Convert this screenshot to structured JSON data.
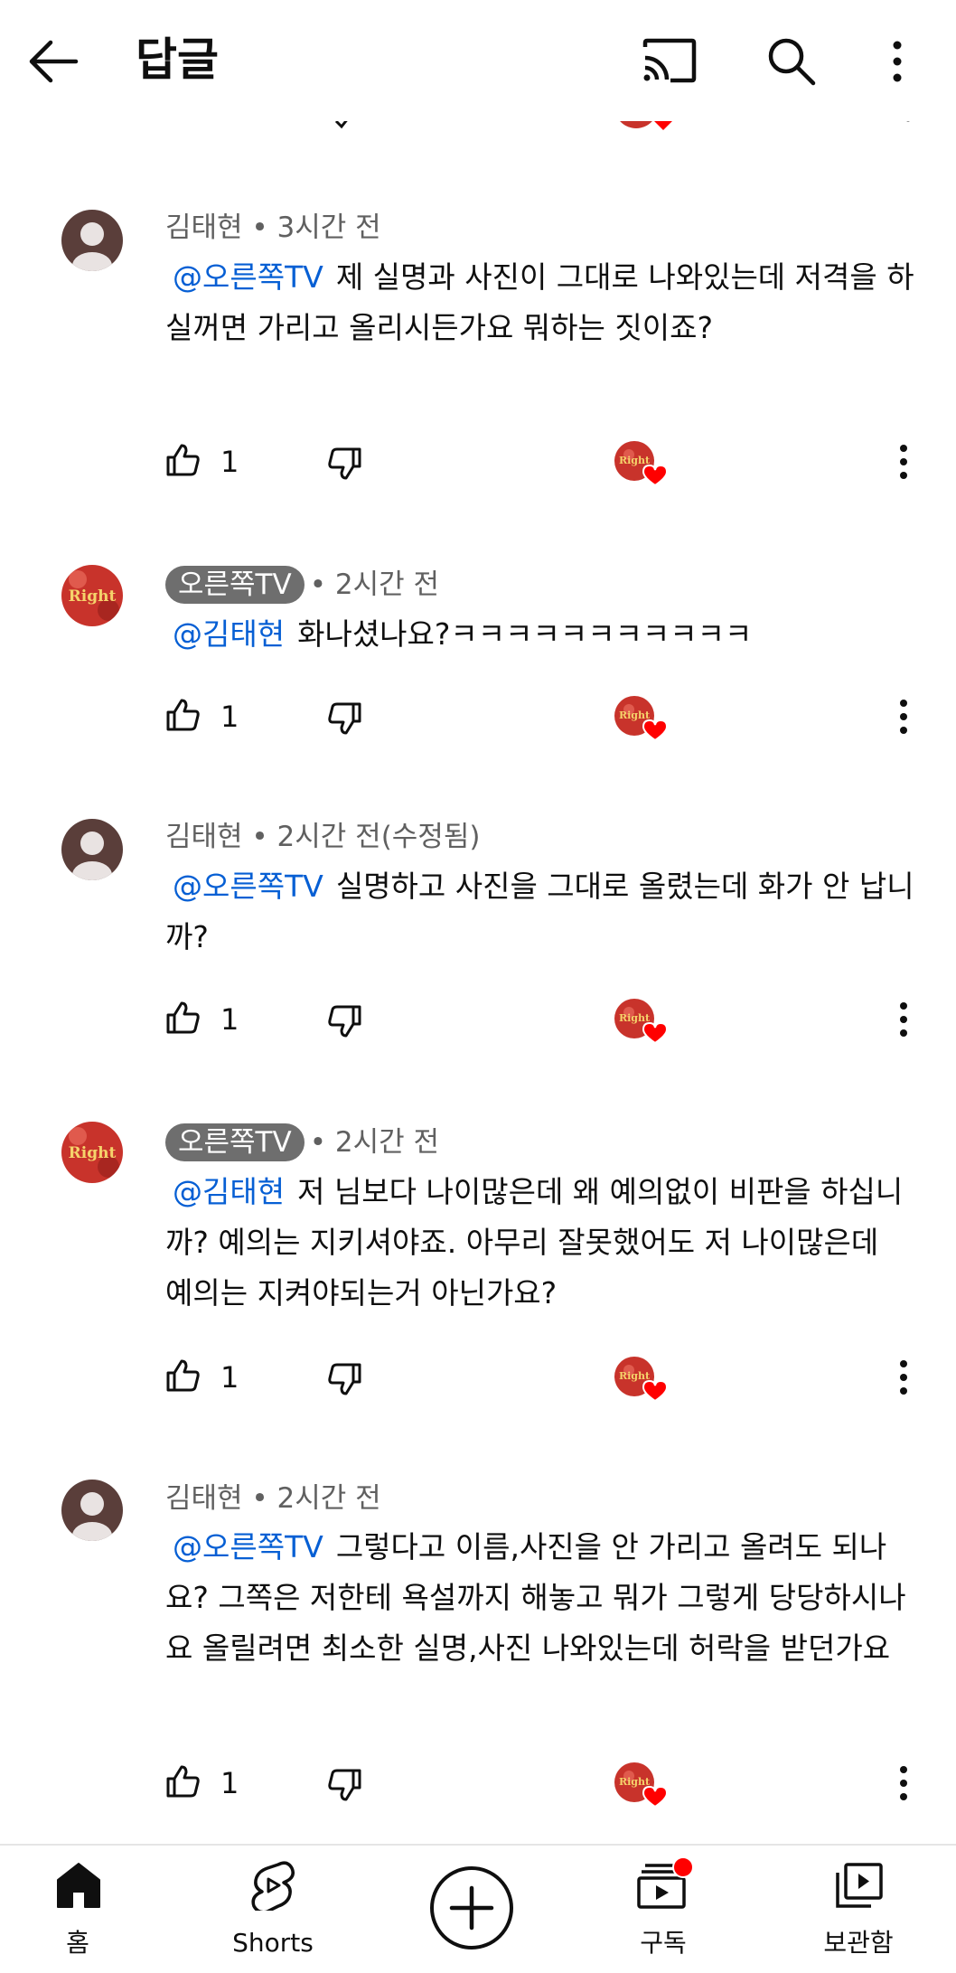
{
  "header": {
    "title": "답글",
    "back_icon": "arrow-left-icon",
    "cast_icon": "cast-icon",
    "search_icon": "search-icon",
    "menu_icon": "more-vertical-icon"
  },
  "comments": [
    {
      "author": "김태현",
      "author_is_channel": false,
      "time": " • 3시간 전",
      "mention": "@오른쪽TV",
      "text": "제 실명과 사진이 그대로 나와있는데 저격을 하실꺼면 가리고 올리시든가요 뭐하는 짓이죠?",
      "likes": "1"
    },
    {
      "author": "오른쪽TV",
      "author_is_channel": true,
      "time": "• 2시간 전",
      "mention": "@김태현",
      "text": "화나셨나요?ㅋㅋㅋㅋㅋㅋㅋㅋㅋㅋㅋ",
      "likes": "1"
    },
    {
      "author": "김태현",
      "author_is_channel": false,
      "time": " • 2시간 전(수정됨)",
      "mention": "@오른쪽TV",
      "text": "실명하고 사진을 그대로 올렸는데 화가 안 납니까?",
      "likes": "1"
    },
    {
      "author": "오른쪽TV",
      "author_is_channel": true,
      "time": "• 2시간 전",
      "mention": "@김태현",
      "text": "저 님보다 나이많은데 왜 예의없이 비판을 하십니까? 예의는 지키셔야죠. 아무리 잘못했어도 저 나이많은데 예의는 지켜야되는거 아닌가요?",
      "likes": "1"
    },
    {
      "author": "김태현",
      "author_is_channel": false,
      "time": " • 2시간 전",
      "mention": "@오른쪽TV",
      "text": "그렇다고 이름,사진을 안 가리고 올려도 되나요? 그쪽은 저한테 욕설까지 해놓고 뭐가 그렇게 당당하시나요 올릴려면 최소한 실명,사진 나와있는데 허락을 받던가요",
      "likes": "1"
    }
  ],
  "channel_logo_text": "Right",
  "bottom_nav": {
    "home": "홈",
    "shorts": "Shorts",
    "subscriptions": "구독",
    "library": "보관함"
  },
  "colors": {
    "mention": "#065fd4",
    "heart": "#ff0000",
    "channel_chip": "#6e6e6e",
    "default_avatar": "#5a3e3a"
  }
}
